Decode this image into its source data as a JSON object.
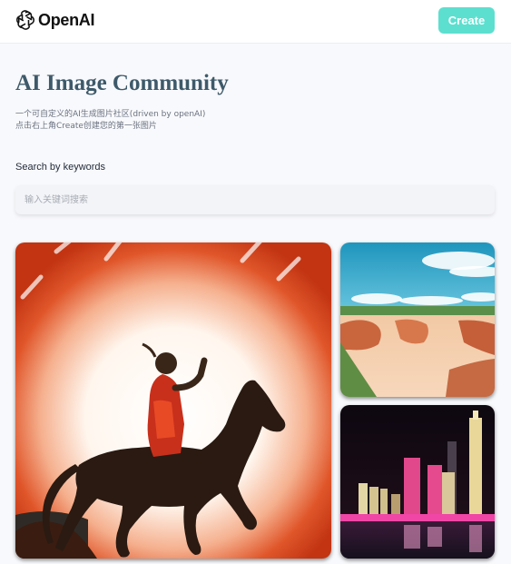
{
  "header": {
    "brand_name": "OpenAI",
    "brand_icon": "openai-logo-icon",
    "create_label": "Create"
  },
  "hero": {
    "title": "AI Image Community",
    "subtitle_line1": "一个可自定义的AI生成图片社区(driven by openAI)",
    "subtitle_line2": "点击右上角Create创建您的第一张图片"
  },
  "search": {
    "label": "Search by keywords",
    "placeholder": "输入关键词搜索",
    "value": ""
  },
  "gallery": {
    "items": [
      {
        "subject": "horse-rider-image",
        "accent": "#d8431b"
      },
      {
        "subject": "canyon-landscape-image",
        "accent": "#2aa6c8"
      },
      {
        "subject": "city-night-skyline-image",
        "accent": "#e8307a"
      }
    ]
  },
  "colors": {
    "create_button": "#5ddfcf",
    "title": "#3e5a6a",
    "page_background": "#f8f9fc"
  }
}
